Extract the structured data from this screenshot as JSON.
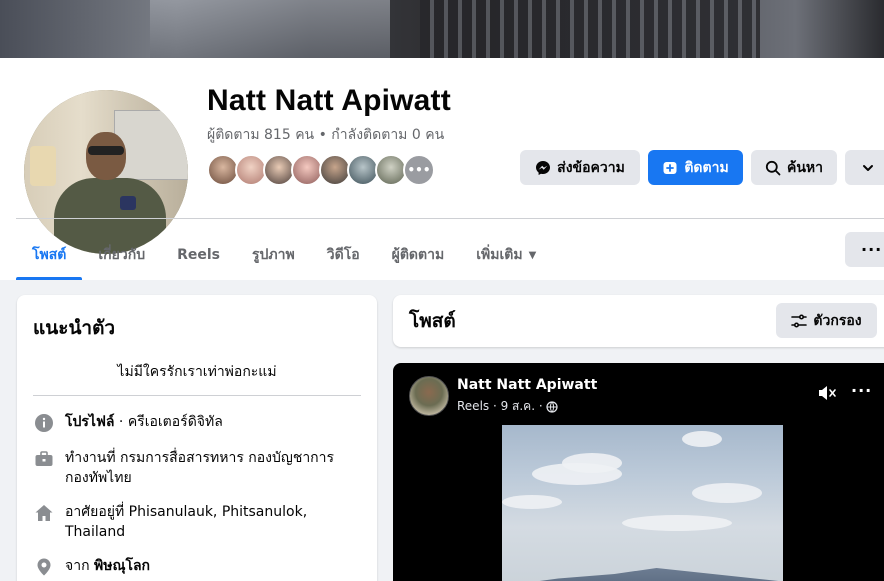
{
  "profile": {
    "name": "Natt Natt Apiwatt",
    "followers_text": "ผู้ติดตาม 815 คน • กำลังติดตาม 0 คน"
  },
  "actions": {
    "message_label": "ส่งข้อความ",
    "follow_label": "ติดตาม",
    "search_label": "ค้นหา"
  },
  "tabs": [
    {
      "label": "โพสต์",
      "active": true
    },
    {
      "label": "เกี่ยวกับ"
    },
    {
      "label": "Reels"
    },
    {
      "label": "รูปภาพ"
    },
    {
      "label": "วิดีโอ"
    },
    {
      "label": "ผู้ติดตาม"
    },
    {
      "label": "เพิ่มเติม"
    }
  ],
  "intro": {
    "title": "แนะนำตัว",
    "bio": "ไม่มีใครรักเราเท่าพ่อกะแม่",
    "profile_label": "โปรไฟล์",
    "profile_category": " · ครีเอเตอร์ดิจิทัล",
    "work": "ทำงานที่ กรมการสื่อสารทหาร กองบัญชาการกองทัพไทย",
    "lives": "อาศัยอยู่ที่ Phisanulauk, Phitsanulok, Thailand",
    "from_prefix": "จาก ",
    "from_place": "พิษณุโลก"
  },
  "posts": {
    "title": "โพสต์",
    "filter_label": "ตัวกรอง",
    "reel": {
      "author": "Natt Natt Apiwatt",
      "meta": "Reels · 9 ส.ค. ·"
    }
  },
  "colors": {
    "brand_blue": "#1877f2",
    "secondary_button": "#e4e6eb",
    "page_bg": "#f0f2f5",
    "muted_text": "#65676b"
  },
  "icons": {
    "message": "messenger-icon",
    "follow": "follow-plus-icon",
    "search": "search-icon",
    "chevron": "chevron-down-icon",
    "more": "more-dots-icon",
    "filter": "filter-icon",
    "info": "info-icon",
    "work": "briefcase-icon",
    "home": "home-icon",
    "location": "location-pin-icon",
    "globe": "globe-icon",
    "mute": "mute-icon"
  }
}
